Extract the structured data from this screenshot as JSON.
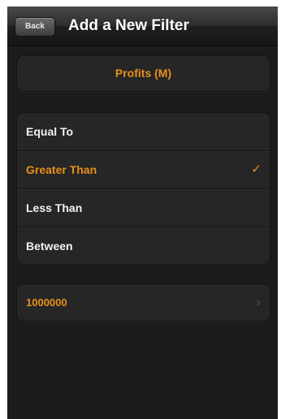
{
  "navbar": {
    "back_label": "Back",
    "title": "Add a New Filter"
  },
  "field": {
    "name": "Profits (M)"
  },
  "options": [
    {
      "label": "Equal To",
      "selected": false
    },
    {
      "label": "Greater Than",
      "selected": true
    },
    {
      "label": "Less Than",
      "selected": false
    },
    {
      "label": "Between",
      "selected": false
    }
  ],
  "checkmark_glyph": "✓",
  "value": {
    "text": "1000000",
    "chevron_glyph": "›"
  },
  "colors": {
    "accent": "#e8901a",
    "background": "#1b1b1b",
    "cell": "#262626"
  }
}
